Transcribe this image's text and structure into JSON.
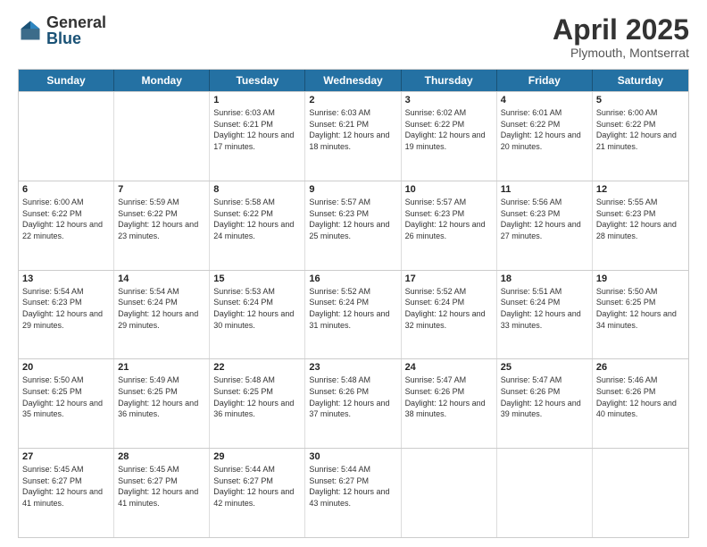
{
  "logo": {
    "general": "General",
    "blue": "Blue"
  },
  "title": {
    "main": "April 2025",
    "sub": "Plymouth, Montserrat"
  },
  "days": [
    "Sunday",
    "Monday",
    "Tuesday",
    "Wednesday",
    "Thursday",
    "Friday",
    "Saturday"
  ],
  "weeks": [
    [
      {
        "day": "",
        "detail": ""
      },
      {
        "day": "",
        "detail": ""
      },
      {
        "day": "1",
        "detail": "Sunrise: 6:03 AM\nSunset: 6:21 PM\nDaylight: 12 hours and 17 minutes."
      },
      {
        "day": "2",
        "detail": "Sunrise: 6:03 AM\nSunset: 6:21 PM\nDaylight: 12 hours and 18 minutes."
      },
      {
        "day": "3",
        "detail": "Sunrise: 6:02 AM\nSunset: 6:22 PM\nDaylight: 12 hours and 19 minutes."
      },
      {
        "day": "4",
        "detail": "Sunrise: 6:01 AM\nSunset: 6:22 PM\nDaylight: 12 hours and 20 minutes."
      },
      {
        "day": "5",
        "detail": "Sunrise: 6:00 AM\nSunset: 6:22 PM\nDaylight: 12 hours and 21 minutes."
      }
    ],
    [
      {
        "day": "6",
        "detail": "Sunrise: 6:00 AM\nSunset: 6:22 PM\nDaylight: 12 hours and 22 minutes."
      },
      {
        "day": "7",
        "detail": "Sunrise: 5:59 AM\nSunset: 6:22 PM\nDaylight: 12 hours and 23 minutes."
      },
      {
        "day": "8",
        "detail": "Sunrise: 5:58 AM\nSunset: 6:22 PM\nDaylight: 12 hours and 24 minutes."
      },
      {
        "day": "9",
        "detail": "Sunrise: 5:57 AM\nSunset: 6:23 PM\nDaylight: 12 hours and 25 minutes."
      },
      {
        "day": "10",
        "detail": "Sunrise: 5:57 AM\nSunset: 6:23 PM\nDaylight: 12 hours and 26 minutes."
      },
      {
        "day": "11",
        "detail": "Sunrise: 5:56 AM\nSunset: 6:23 PM\nDaylight: 12 hours and 27 minutes."
      },
      {
        "day": "12",
        "detail": "Sunrise: 5:55 AM\nSunset: 6:23 PM\nDaylight: 12 hours and 28 minutes."
      }
    ],
    [
      {
        "day": "13",
        "detail": "Sunrise: 5:54 AM\nSunset: 6:23 PM\nDaylight: 12 hours and 29 minutes."
      },
      {
        "day": "14",
        "detail": "Sunrise: 5:54 AM\nSunset: 6:24 PM\nDaylight: 12 hours and 29 minutes."
      },
      {
        "day": "15",
        "detail": "Sunrise: 5:53 AM\nSunset: 6:24 PM\nDaylight: 12 hours and 30 minutes."
      },
      {
        "day": "16",
        "detail": "Sunrise: 5:52 AM\nSunset: 6:24 PM\nDaylight: 12 hours and 31 minutes."
      },
      {
        "day": "17",
        "detail": "Sunrise: 5:52 AM\nSunset: 6:24 PM\nDaylight: 12 hours and 32 minutes."
      },
      {
        "day": "18",
        "detail": "Sunrise: 5:51 AM\nSunset: 6:24 PM\nDaylight: 12 hours and 33 minutes."
      },
      {
        "day": "19",
        "detail": "Sunrise: 5:50 AM\nSunset: 6:25 PM\nDaylight: 12 hours and 34 minutes."
      }
    ],
    [
      {
        "day": "20",
        "detail": "Sunrise: 5:50 AM\nSunset: 6:25 PM\nDaylight: 12 hours and 35 minutes."
      },
      {
        "day": "21",
        "detail": "Sunrise: 5:49 AM\nSunset: 6:25 PM\nDaylight: 12 hours and 36 minutes."
      },
      {
        "day": "22",
        "detail": "Sunrise: 5:48 AM\nSunset: 6:25 PM\nDaylight: 12 hours and 36 minutes."
      },
      {
        "day": "23",
        "detail": "Sunrise: 5:48 AM\nSunset: 6:26 PM\nDaylight: 12 hours and 37 minutes."
      },
      {
        "day": "24",
        "detail": "Sunrise: 5:47 AM\nSunset: 6:26 PM\nDaylight: 12 hours and 38 minutes."
      },
      {
        "day": "25",
        "detail": "Sunrise: 5:47 AM\nSunset: 6:26 PM\nDaylight: 12 hours and 39 minutes."
      },
      {
        "day": "26",
        "detail": "Sunrise: 5:46 AM\nSunset: 6:26 PM\nDaylight: 12 hours and 40 minutes."
      }
    ],
    [
      {
        "day": "27",
        "detail": "Sunrise: 5:45 AM\nSunset: 6:27 PM\nDaylight: 12 hours and 41 minutes."
      },
      {
        "day": "28",
        "detail": "Sunrise: 5:45 AM\nSunset: 6:27 PM\nDaylight: 12 hours and 41 minutes."
      },
      {
        "day": "29",
        "detail": "Sunrise: 5:44 AM\nSunset: 6:27 PM\nDaylight: 12 hours and 42 minutes."
      },
      {
        "day": "30",
        "detail": "Sunrise: 5:44 AM\nSunset: 6:27 PM\nDaylight: 12 hours and 43 minutes."
      },
      {
        "day": "",
        "detail": ""
      },
      {
        "day": "",
        "detail": ""
      },
      {
        "day": "",
        "detail": ""
      }
    ]
  ]
}
